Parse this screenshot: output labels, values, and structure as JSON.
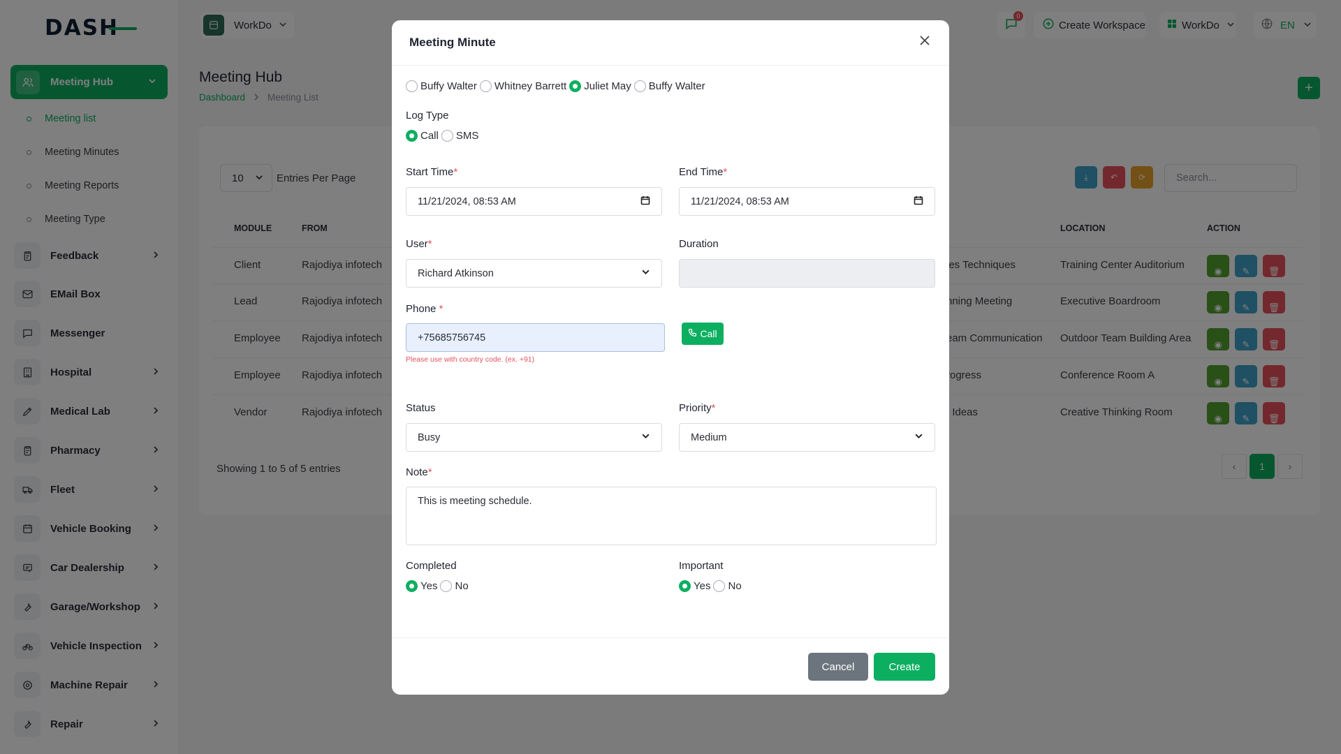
{
  "app": {
    "logo": "DASH"
  },
  "sidebar": {
    "active": {
      "label": "Meeting Hub",
      "icon": "users-icon"
    },
    "subitems": [
      {
        "label": "Meeting list",
        "active": true
      },
      {
        "label": "Meeting Minutes",
        "active": false
      },
      {
        "label": "Meeting Reports",
        "active": false
      },
      {
        "label": "Meeting Type",
        "active": false
      }
    ],
    "items": [
      {
        "label": "Feedback",
        "icon": "clipboard-icon",
        "arrow": true
      },
      {
        "label": "EMail Box",
        "icon": "mail-icon",
        "arrow": false
      },
      {
        "label": "Messenger",
        "icon": "chat-icon",
        "arrow": false
      },
      {
        "label": "Hospital",
        "icon": "building-icon",
        "arrow": true
      },
      {
        "label": "Medical Lab",
        "icon": "pen-icon",
        "arrow": true
      },
      {
        "label": "Pharmacy",
        "icon": "clipboard-icon",
        "arrow": true
      },
      {
        "label": "Fleet",
        "icon": "truck-icon",
        "arrow": true
      },
      {
        "label": "Vehicle Booking",
        "icon": "calendar-icon",
        "arrow": true
      },
      {
        "label": "Car Dealership",
        "icon": "car-icon",
        "arrow": true
      },
      {
        "label": "Garage/Workshop",
        "icon": "wrench-icon",
        "arrow": true
      },
      {
        "label": "Vehicle Inspection",
        "icon": "bike-icon",
        "arrow": true
      },
      {
        "label": "Machine Repair",
        "icon": "gear-icon",
        "arrow": true
      },
      {
        "label": "Repair",
        "icon": "wrench-icon",
        "arrow": true
      }
    ]
  },
  "header": {
    "workspace": "WorkDo",
    "notification_count": "0",
    "create_workspace": "Create Workspace",
    "workspace_menu": "WorkDo",
    "language": "EN"
  },
  "page": {
    "title": "Meeting Hub",
    "breadcrumb": {
      "home": "Dashboard",
      "current": "Meeting List"
    },
    "entries_value": "10",
    "entries_label": "Entries Per Page",
    "search_placeholder": "Search...",
    "showing": "Showing 1 to 5 of 5 entries",
    "page_number": "1",
    "columns": {
      "module": "MODULE",
      "from": "FROM",
      "location": "LOCATION",
      "action": "ACTION"
    },
    "rows": [
      {
        "module": "Client",
        "from": "Rajodiya infotech",
        "title": "les Techniques",
        "location": "Training Center Auditorium"
      },
      {
        "module": "Lead",
        "from": "Rajodiya infotech",
        "title": "nning Meeting",
        "location": "Executive Boardroom"
      },
      {
        "module": "Employee",
        "from": "Rajodiya infotech",
        "title": "eam Communication",
        "location": "Outdoor Team Building Area"
      },
      {
        "module": "Employee",
        "from": "Rajodiya infotech",
        "title": "rogress",
        "location": "Conference Room A"
      },
      {
        "module": "Vendor",
        "from": "Rajodiya infotech",
        "title": "t Ideas",
        "location": "Creative Thinking Room"
      }
    ]
  },
  "modal": {
    "title": "Meeting Minute",
    "attendees": [
      {
        "label": "Buffy Walter",
        "checked": false
      },
      {
        "label": "Whitney Barrett",
        "checked": false
      },
      {
        "label": "Juliet May",
        "checked": true
      },
      {
        "label": "Buffy Walter",
        "checked": false
      }
    ],
    "log_type_label": "Log Type",
    "log_types": [
      {
        "label": "Call",
        "checked": true
      },
      {
        "label": "SMS",
        "checked": false
      }
    ],
    "start_time_label": "Start Time",
    "start_time": "11/21/2024, 08:53 AM",
    "end_time_label": "End Time",
    "end_time": "11/21/2024, 08:53 AM",
    "user_label": "User",
    "user": "Richard Atkinson",
    "duration_label": "Duration",
    "duration": "",
    "phone_label": "Phone",
    "phone": "+75685756745",
    "phone_hint": "Please use with country code. (ex. +91)",
    "call_button": "Call",
    "status_label": "Status",
    "status": "Busy",
    "priority_label": "Priority",
    "priority": "Medium",
    "note_label": "Note",
    "note": "This is meeting schedule.",
    "completed_label": "Completed",
    "completed": [
      {
        "label": "Yes",
        "checked": true
      },
      {
        "label": "No",
        "checked": false
      }
    ],
    "important_label": "Important",
    "important": [
      {
        "label": "Yes",
        "checked": true
      },
      {
        "label": "No",
        "checked": false
      }
    ],
    "cancel": "Cancel",
    "create": "Create"
  },
  "colors": {
    "accent": "#0caf60",
    "danger": "#e7515a",
    "info": "#3ea0c6",
    "warning": "#e6a12a"
  }
}
